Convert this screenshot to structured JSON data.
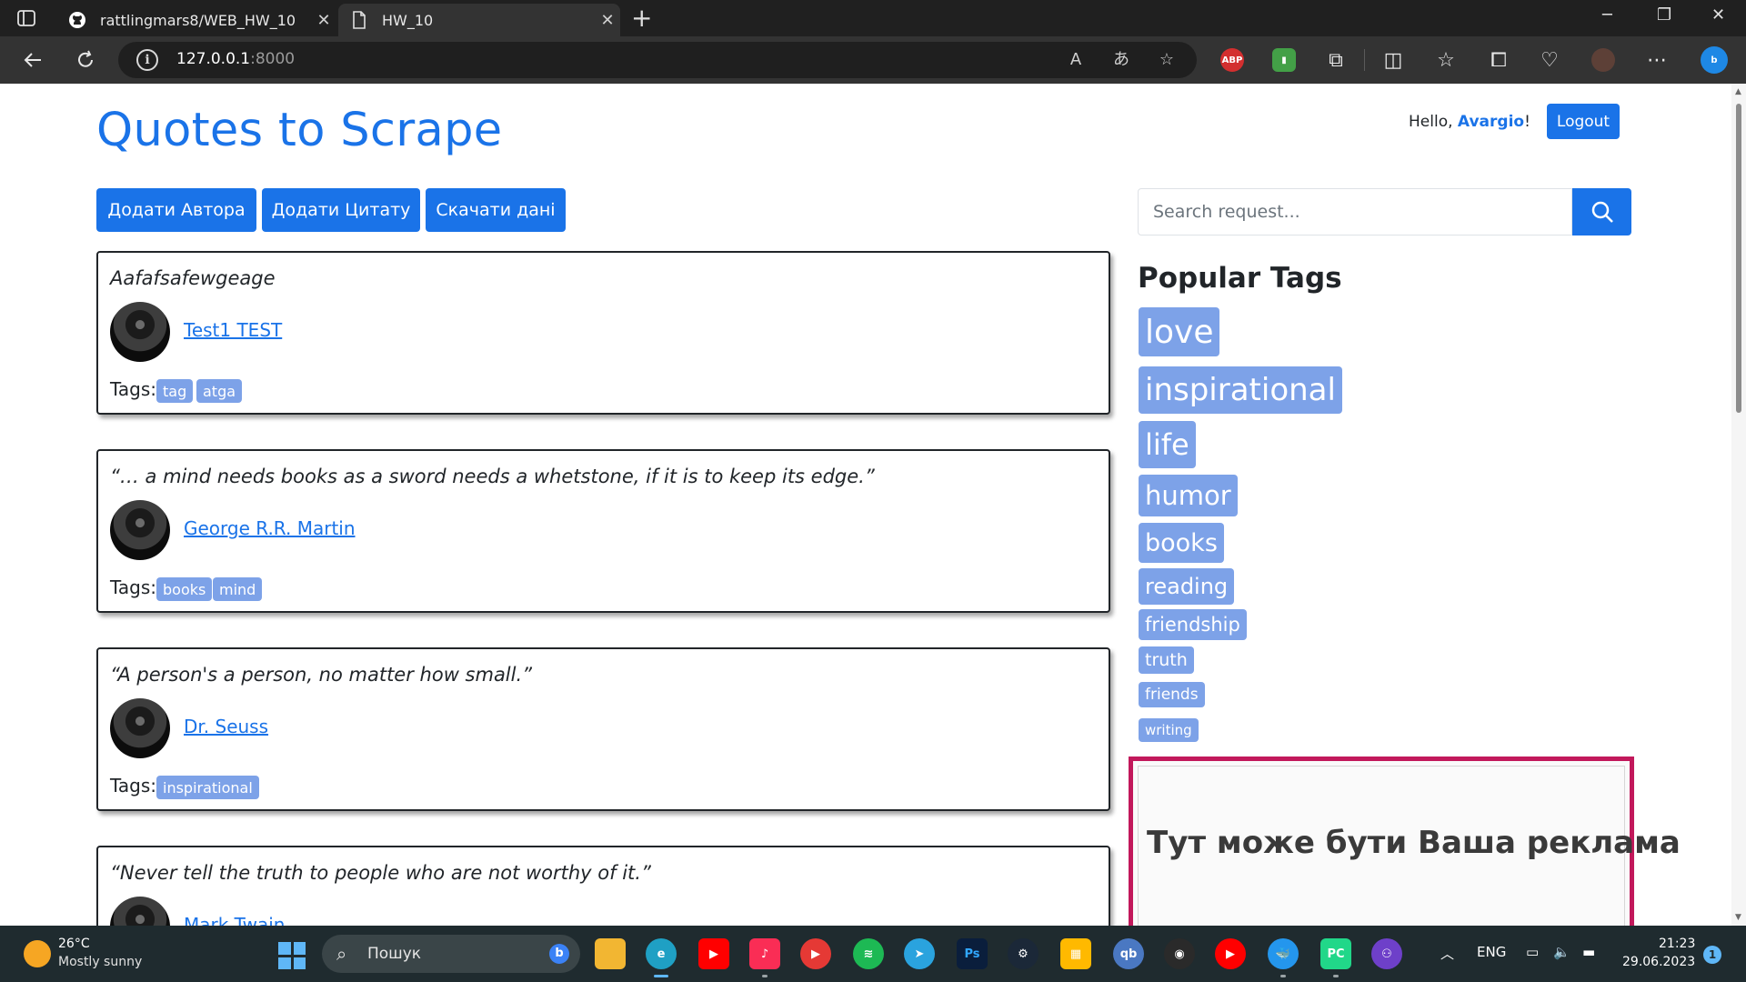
{
  "browser": {
    "tabs": [
      {
        "title": "rattlingmars8/WEB_HW_10",
        "icon": "github-icon"
      },
      {
        "title": "HW_10",
        "icon": "page-icon"
      }
    ],
    "url": "127.0.0.1",
    "port": ":8000"
  },
  "header": {
    "title": "Quotes to Scrape",
    "greeting_prefix": "Hello, ",
    "username": "Avargio",
    "greeting_suffix": "!",
    "logout_label": "Logout"
  },
  "actions": {
    "add_author": "Додати Автора",
    "add_quote": "Додати Цитату",
    "download_data": "Скачати дані"
  },
  "search": {
    "placeholder": "Search request..."
  },
  "quotes": [
    {
      "text": "Aafafsafewgeage",
      "author": " Test1 TEST",
      "tags": [
        "tag",
        "atga"
      ]
    },
    {
      "text": "“… a mind needs books as a sword needs a whetstone, if it is to keep its edge.”",
      "author": " George R.R. Martin",
      "tags": [
        "books",
        "mind"
      ]
    },
    {
      "text": "“A person's a person, no matter how small.”",
      "author": " Dr. Seuss",
      "tags": [
        "inspirational"
      ]
    },
    {
      "text": "“Never tell the truth to people who are not worthy of it.”",
      "author": " Mark Twain",
      "tags": []
    }
  ],
  "tags_label": "Tags:",
  "popular_tags": {
    "title": "Popular Tags",
    "tags": [
      "love",
      "inspirational",
      "life",
      "humor",
      "books",
      "reading",
      "friendship",
      "truth",
      "friends",
      "writing"
    ]
  },
  "ad": {
    "text": "Тут може бути Ваша реклама"
  },
  "taskbar": {
    "weather_temp": "26°C",
    "weather_desc": "Mostly sunny",
    "search_placeholder": "Пошук",
    "language": "ENG",
    "time": "21:23",
    "date": "29.06.2023",
    "notifications": "1"
  },
  "colors": {
    "accent": "#1a73e8",
    "tag_badge": "#7da2e8",
    "ad_border": "#c2185b"
  }
}
